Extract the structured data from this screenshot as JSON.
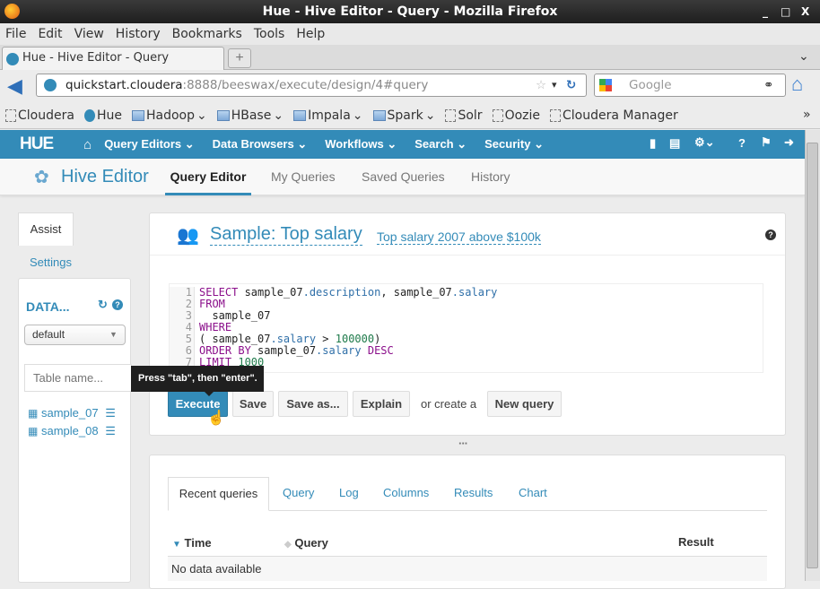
{
  "window": {
    "title": "Hue - Hive Editor - Query Mozilla Firefox",
    "title_text": "Hue - Hive Editor - Query - Mozilla Firefox",
    "controls": [
      "_",
      "□",
      "X"
    ]
  },
  "menu": [
    "File",
    "Edit",
    "View",
    "History",
    "Bookmarks",
    "Tools",
    "Help"
  ],
  "browser_tab": {
    "label": "Hue - Hive Editor - Query",
    "new_tab": "+"
  },
  "url": {
    "host": "quickstart.cloudera",
    "path": ":8888/beeswax/execute/design/4#query"
  },
  "search": {
    "placeholder": "Google"
  },
  "bookmarks": [
    {
      "label": "Cloudera",
      "icon": "page"
    },
    {
      "label": "Hue",
      "icon": "hue"
    },
    {
      "label": "Hadoop",
      "icon": "folder",
      "dropdown": true
    },
    {
      "label": "HBase",
      "icon": "folder",
      "dropdown": true
    },
    {
      "label": "Impala",
      "icon": "folder",
      "dropdown": true
    },
    {
      "label": "Spark",
      "icon": "folder",
      "dropdown": true
    },
    {
      "label": "Solr",
      "icon": "page"
    },
    {
      "label": "Oozie",
      "icon": "page"
    },
    {
      "label": "Cloudera Manager",
      "icon": "page"
    }
  ],
  "hue": {
    "logo": "HUE",
    "nav": [
      "Query Editors",
      "Data Browsers",
      "Workflows",
      "Search",
      "Security"
    ],
    "brand_color": "#338bb8"
  },
  "subnav": {
    "app": "Hive Editor",
    "items": [
      "Query Editor",
      "My Queries",
      "Saved Queries",
      "History"
    ],
    "active": "Query Editor"
  },
  "sidebar": {
    "tabs": [
      "Assist",
      "Settings"
    ],
    "db_label": "DATA...",
    "db_select": "default",
    "table_placeholder": "Table name...",
    "tables": [
      "sample_07",
      "sample_08"
    ]
  },
  "query": {
    "name": "Sample: Top salary",
    "description": "Top salary 2007 above $100k",
    "lines": [
      [
        [
          "kw",
          "SELECT"
        ],
        [
          "t",
          " sample_07"
        ],
        [
          "pr",
          ".description"
        ],
        [
          "t",
          ", sample_07"
        ],
        [
          "pr",
          ".salary"
        ]
      ],
      [
        [
          "kw",
          "FROM"
        ]
      ],
      [
        [
          "t",
          "  sample_07"
        ]
      ],
      [
        [
          "kw",
          "WHERE"
        ]
      ],
      [
        [
          "t",
          "( sample_07"
        ],
        [
          "pr",
          ".salary"
        ],
        [
          "t",
          " > "
        ],
        [
          "nm",
          "100000"
        ],
        [
          "t",
          ")"
        ]
      ],
      [
        [
          "kw",
          "ORDER BY"
        ],
        [
          "t",
          " sample_07"
        ],
        [
          "pr",
          ".salary"
        ],
        [
          "kw",
          " DESC"
        ]
      ],
      [
        [
          "kw",
          "LIMIT"
        ],
        [
          "nm",
          " 1000"
        ]
      ]
    ]
  },
  "buttons": {
    "execute": "Execute",
    "save": "Save",
    "save_as": "Save as...",
    "explain": "Explain",
    "or_create": "or create a",
    "new_query": "New query"
  },
  "tooltip": "Press \"tab\", then \"enter\".",
  "results": {
    "tabs": [
      "Recent queries",
      "Query",
      "Log",
      "Columns",
      "Results",
      "Chart"
    ],
    "active": "Recent queries",
    "columns": [
      "Time",
      "Query",
      "Result"
    ],
    "empty": "No data available"
  }
}
